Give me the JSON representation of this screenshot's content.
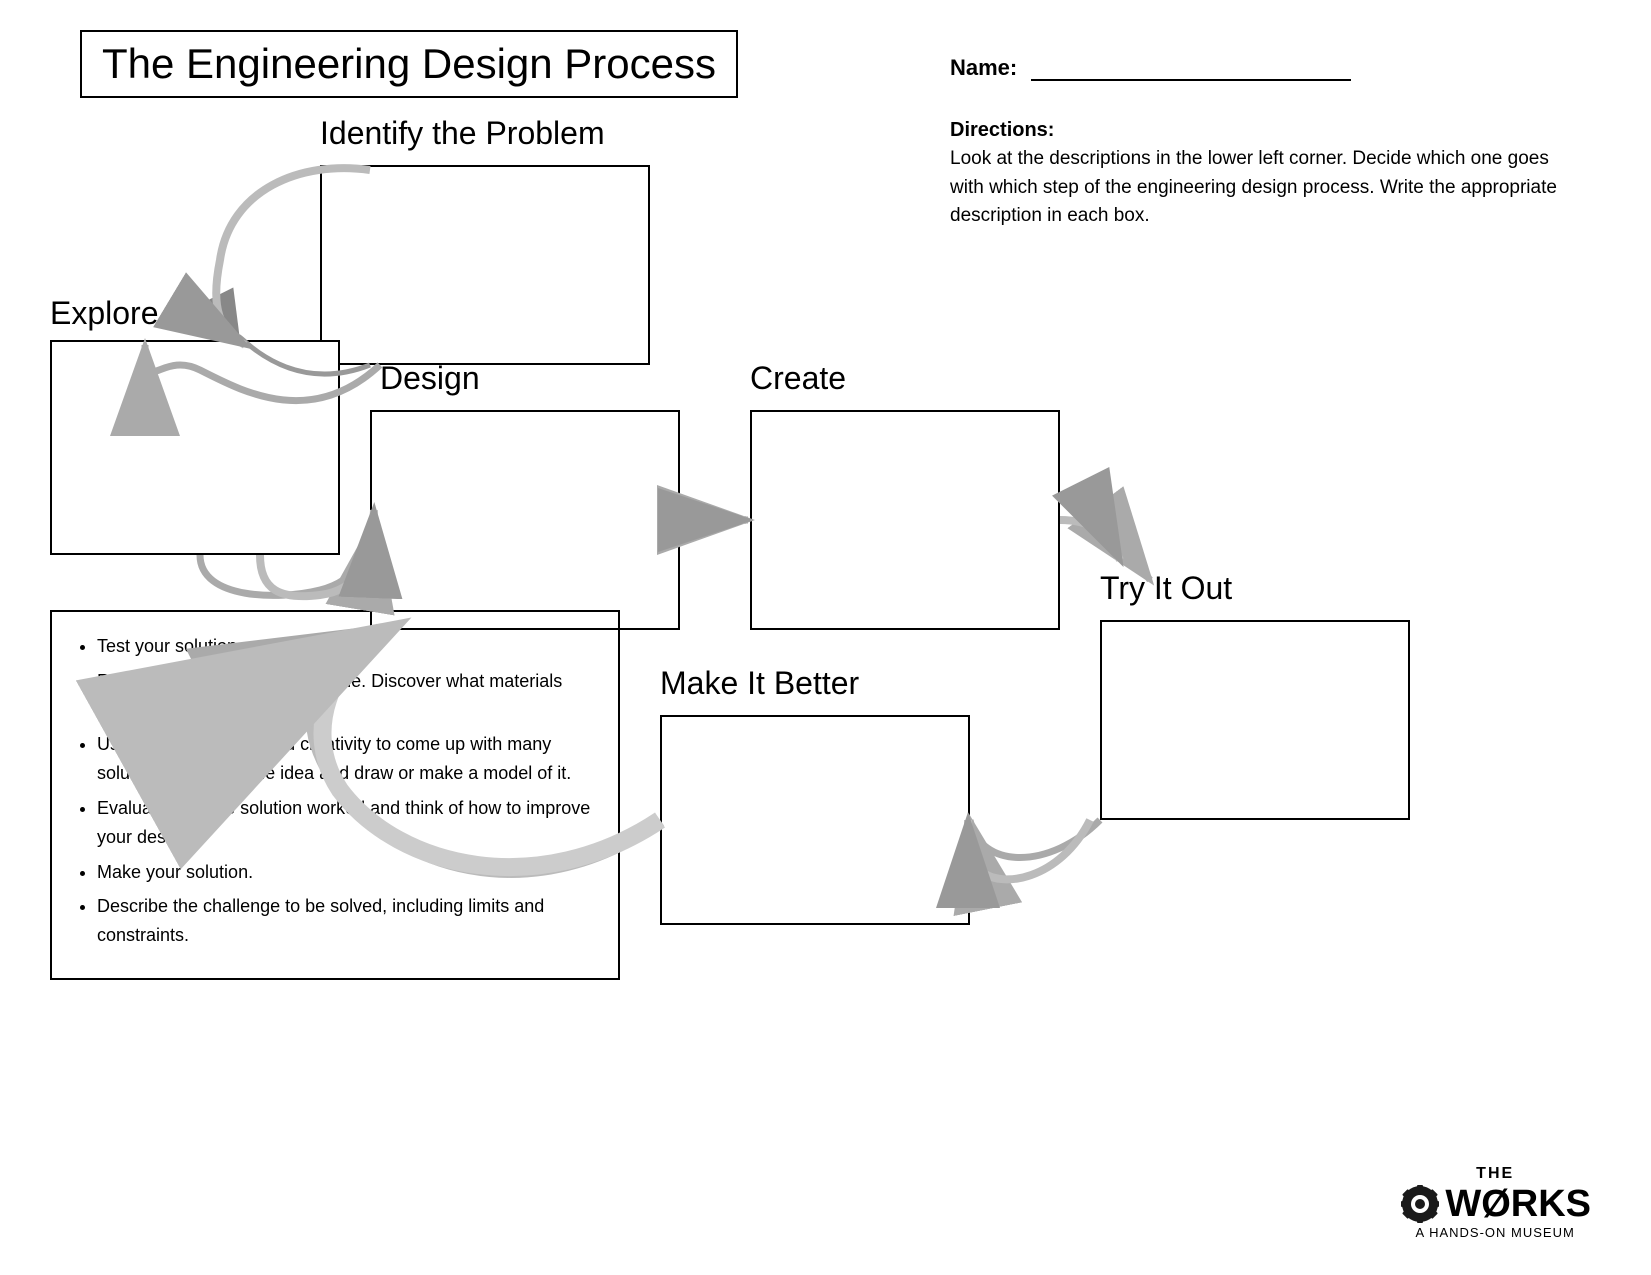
{
  "title": "The Engineering Design Process",
  "name_label": "Name:",
  "directions_title": "Directions:",
  "directions_text": "Look at the descriptions in the lower left corner. Decide which one goes with which step of the engineering design process.  Write the appropriate description in each box.",
  "steps": {
    "identify": "Identify the Problem",
    "explore": "Explore",
    "design": "Design",
    "create": "Create",
    "try_it_out": "Try It Out",
    "make_it_better": "Make It Better"
  },
  "bullets": [
    "Test your solution.",
    "Research what others have done.  Discover what materials are available.",
    "Use your knowledge and creativity to come up with many solutions.  Choose one idea and draw or make a model of it.",
    "Evaluate how the solution worked and think of how to improve your design.",
    "Make your solution.",
    "Describe the challenge to be solved, including limits and constraints."
  ],
  "logo": {
    "the": "THE",
    "works": "W RKS",
    "subtitle": "A Hands-On Museum"
  }
}
